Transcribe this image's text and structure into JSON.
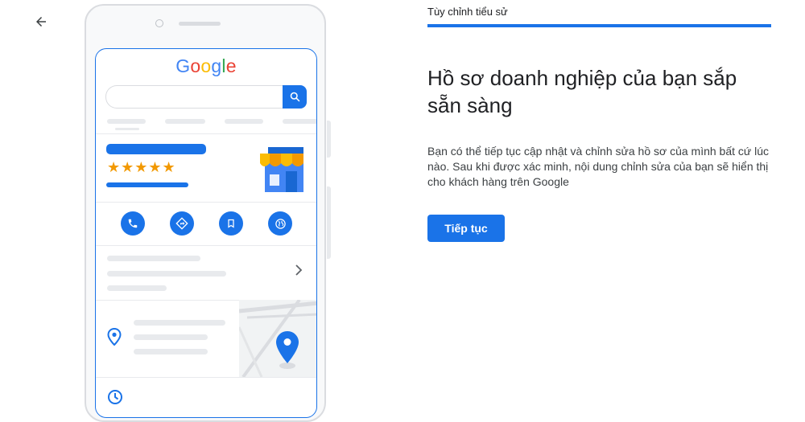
{
  "header": {
    "step_title": "Tùy chỉnh tiểu sử",
    "progress_percent": 100,
    "back_icon": "arrow-back-icon"
  },
  "main": {
    "headline": "Hồ sơ doanh nghiệp của bạn sắp sẵn sàng",
    "description": "Bạn có thể tiếp tục cập nhật và chỉnh sửa hồ sơ của mình bất cứ lúc nào. Sau khi được xác minh, nội dung chỉnh sửa của bạn sẽ hiển thị cho khách hàng trên Google",
    "continue_label": "Tiếp tục"
  },
  "illustration": {
    "logo_text": "Google",
    "rating_stars": 5,
    "icons": [
      "search-icon",
      "store-icon",
      "phone-icon",
      "directions-icon",
      "bookmark-icon",
      "website-icon",
      "chevron-right-icon",
      "location-pin-icon",
      "map-pin-icon",
      "clock-icon"
    ]
  },
  "colors": {
    "accent": "#1a73e8",
    "star": "#f29900",
    "google_blue": "#4285f4",
    "google_red": "#ea4335",
    "google_yellow": "#fbbc05",
    "google_green": "#34a853"
  }
}
